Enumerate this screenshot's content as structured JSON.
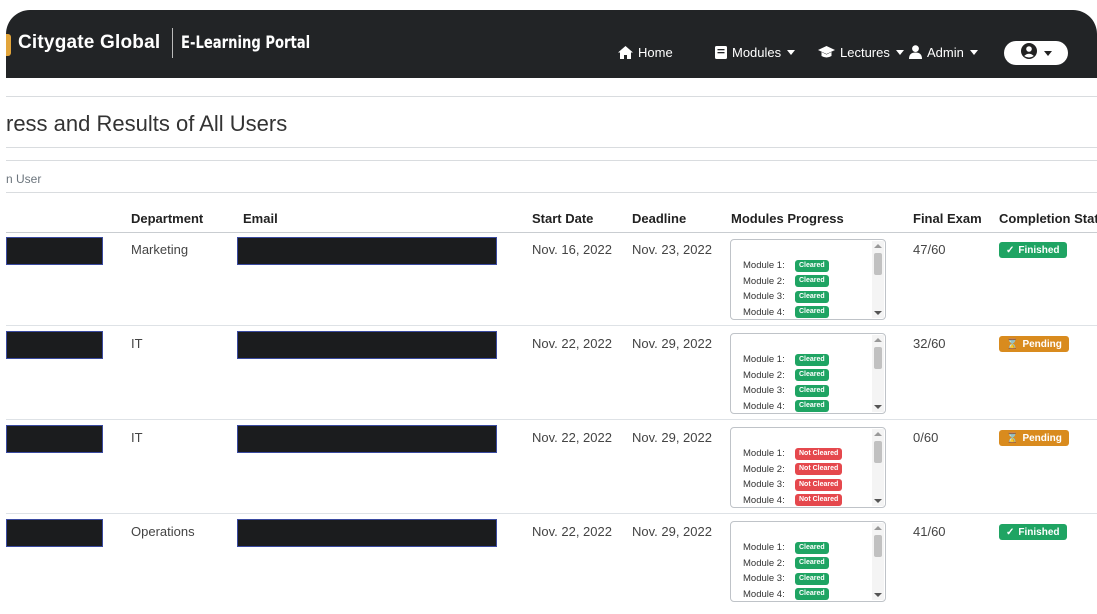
{
  "navbar": {
    "brand": "Citygate Global",
    "brand_sub": "E-Learning Portal",
    "items": [
      {
        "label": "Home",
        "icon": "home-icon"
      },
      {
        "label": "Modules",
        "icon": "book-icon"
      },
      {
        "label": "Lectures",
        "icon": "graduation-cap-icon"
      },
      {
        "label": "Admin",
        "icon": "user-icon"
      }
    ],
    "account_icon": "user-circle-icon"
  },
  "page": {
    "title": "ress and Results of All Users",
    "filter_label": "n User"
  },
  "table": {
    "headers": {
      "department": "Department",
      "email": "Email",
      "start_date": "Start Date",
      "deadline": "Deadline",
      "modules_progress": "Modules Progress",
      "final_exam": "Final Exam",
      "completion_status": "Completion Stat"
    },
    "rows": [
      {
        "department": "Marketing",
        "start_date": "Nov. 16, 2022",
        "deadline": "Nov. 23, 2022",
        "modules": [
          {
            "label": "Module 1:",
            "status": "Cleared"
          },
          {
            "label": "Module 2:",
            "status": "Cleared"
          },
          {
            "label": "Module 3:",
            "status": "Cleared"
          },
          {
            "label": "Module 4:",
            "status": "Cleared"
          }
        ],
        "final_exam": "47/60",
        "completion": "Finished"
      },
      {
        "department": "IT",
        "start_date": "Nov. 22, 2022",
        "deadline": "Nov. 29, 2022",
        "modules": [
          {
            "label": "Module 1:",
            "status": "Cleared"
          },
          {
            "label": "Module 2:",
            "status": "Cleared"
          },
          {
            "label": "Module 3:",
            "status": "Cleared"
          },
          {
            "label": "Module 4:",
            "status": "Cleared"
          }
        ],
        "final_exam": "32/60",
        "completion": "Pending"
      },
      {
        "department": "IT",
        "start_date": "Nov. 22, 2022",
        "deadline": "Nov. 29, 2022",
        "modules": [
          {
            "label": "Module 1:",
            "status": "Not Cleared"
          },
          {
            "label": "Module 2:",
            "status": "Not Cleared"
          },
          {
            "label": "Module 3:",
            "status": "Not Cleared"
          },
          {
            "label": "Module 4:",
            "status": "Not Cleared"
          }
        ],
        "final_exam": "0/60",
        "completion": "Pending"
      },
      {
        "department": "Operations",
        "start_date": "Nov. 22, 2022",
        "deadline": "Nov. 29, 2022",
        "modules": [
          {
            "label": "Module 1:",
            "status": "Cleared"
          },
          {
            "label": "Module 2:",
            "status": "Cleared"
          },
          {
            "label": "Module 3:",
            "status": "Cleared"
          },
          {
            "label": "Module 4:",
            "status": "Cleared"
          }
        ],
        "final_exam": "41/60",
        "completion": "Finished"
      }
    ]
  },
  "colors": {
    "navbar": "#222426",
    "cleared": "#1fa463",
    "not_cleared": "#e5484d",
    "finished": "#1fa463",
    "pending": "#d98b1e"
  }
}
